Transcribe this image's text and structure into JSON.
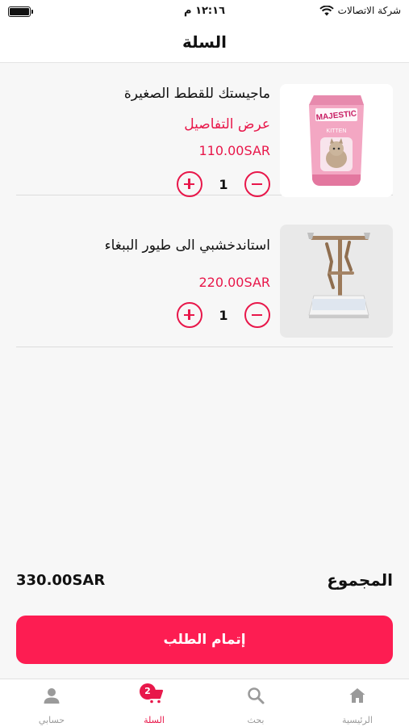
{
  "status_bar": {
    "time": "١٢:١٦ م",
    "carrier": "شركة الاتصالات"
  },
  "header": {
    "title": "السلة"
  },
  "cart": {
    "items": [
      {
        "name": "ماجيستك للقطط الصغيرة",
        "details_link": "عرض التفاصيل",
        "price": "110.00SAR",
        "quantity": "1",
        "image": "cat-food-bag",
        "package_brand": "MAJESTIC",
        "package_variant": "KITTEN"
      },
      {
        "name": "استاندخشبي الى طيور الببغاء",
        "price": "220.00SAR",
        "quantity": "1",
        "image": "wooden-parrot-stand"
      }
    ]
  },
  "summary": {
    "total_label": "المجموع",
    "total_value": "330.00SAR"
  },
  "checkout": {
    "label": "إتمام الطلب"
  },
  "tabbar": {
    "tabs": [
      {
        "label": "الرئيسية",
        "icon": "home-icon"
      },
      {
        "label": "بحث",
        "icon": "search-icon"
      },
      {
        "label": "السلة",
        "icon": "cart-icon",
        "badge": "2",
        "active": true
      },
      {
        "label": "حسابي",
        "icon": "user-icon"
      }
    ]
  },
  "colors": {
    "accent": "#e8174a",
    "button": "#fd1d52",
    "background": "#f7f7f7"
  }
}
